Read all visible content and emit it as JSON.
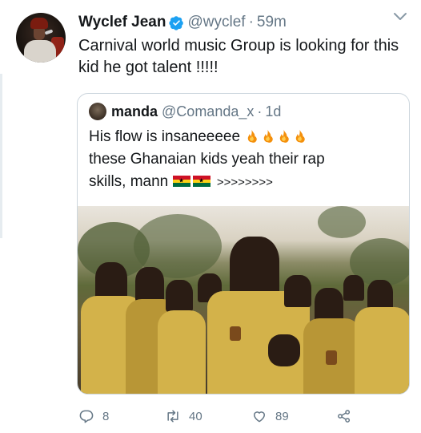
{
  "tweet": {
    "author_name": "Wyclef Jean",
    "handle": "@wyclef",
    "separator": "·",
    "time": "59m",
    "text": "Carnival world music Group is looking for this kid he got talent !!!!!"
  },
  "quoted_tweet": {
    "author_name": "manda",
    "handle": "@Comanda_x",
    "separator": "·",
    "time": "1d",
    "line1": "His flow is insaneeeee",
    "line2": "these Ghanaian kids yeah their rap",
    "line3": "skills, mann",
    "arrows": ">>>>>>>>",
    "flag_colors": [
      "#ce1126",
      "#fcd116",
      "#006b3f"
    ],
    "fire_emoji_count": 4
  },
  "actions": {
    "reply_count": "8",
    "retweet_count": "40",
    "like_count": "89"
  },
  "colors": {
    "text": "#14171a",
    "secondary": "#657786",
    "verified": "#1da1f2",
    "border": "#ccd6dd"
  }
}
